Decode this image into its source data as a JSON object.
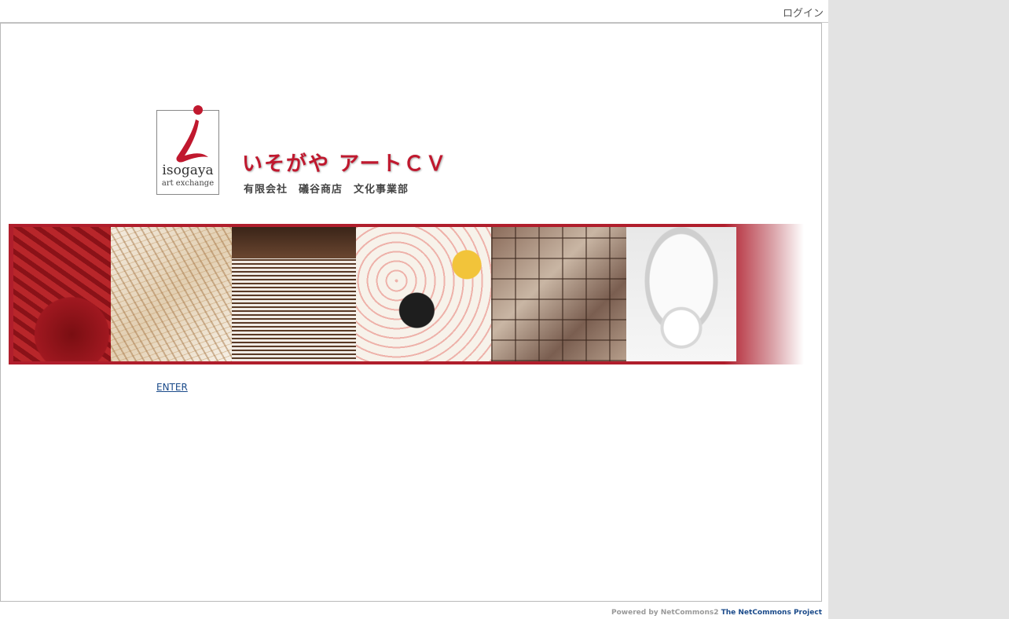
{
  "header": {
    "login_label": "ログイン"
  },
  "logo": {
    "word": "isogaya",
    "sub": "art exchange",
    "accent_color": "#c0182e"
  },
  "site": {
    "title": "いそがや アートＣＶ",
    "subtitle": "有限会社　礒谷商店　文化事業部"
  },
  "banner": {
    "panels": [
      {
        "name": "red-abstract-painting"
      },
      {
        "name": "thread-sculpture"
      },
      {
        "name": "stacked-books-sculpture"
      },
      {
        "name": "figure-painting"
      },
      {
        "name": "collage-painting"
      },
      {
        "name": "white-ceramic-sculpture"
      }
    ]
  },
  "main": {
    "enter_label": "ENTER"
  },
  "footer": {
    "powered": "Powered by NetCommons2 ",
    "project": "The NetCommons Project"
  },
  "colors": {
    "banner_red": "#b01e2c",
    "link": "#1a4a8a",
    "gutter": "#e3e3e3"
  }
}
